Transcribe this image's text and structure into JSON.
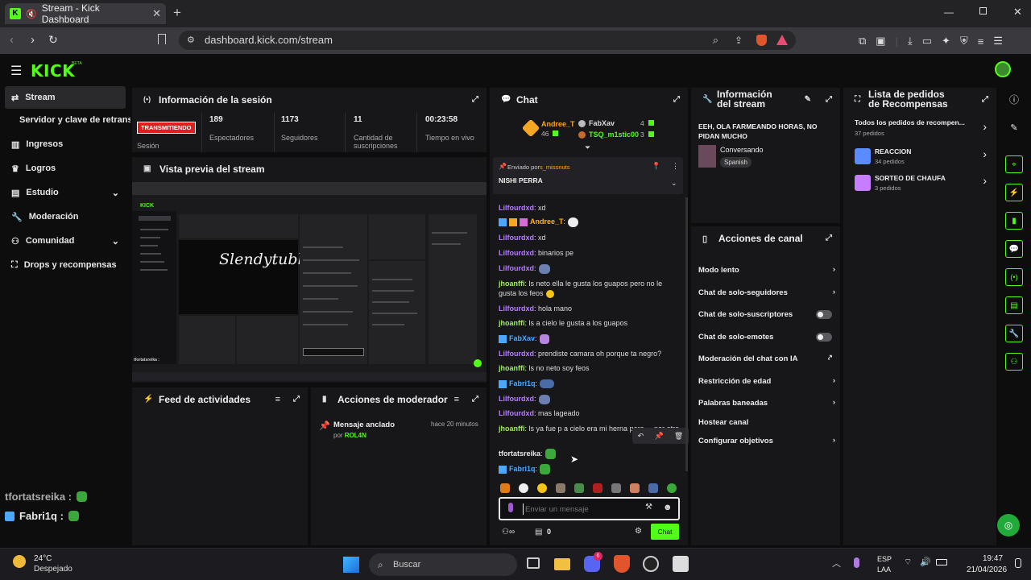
{
  "browser": {
    "tab_title": "Stream - Kick Dashboard",
    "url": "dashboard.kick.com/stream"
  },
  "brand": {
    "logo": "KICK",
    "beta": "BETA",
    "accent": "#53fc18"
  },
  "nav": {
    "items": [
      {
        "label": "Stream",
        "icon": "stream-icon"
      },
      {
        "label": "Servidor y clave de retransn",
        "icon": ""
      },
      {
        "label": "Ingresos",
        "icon": "chart-icon"
      },
      {
        "label": "Logros",
        "icon": "trophy-icon"
      },
      {
        "label": "Estudio",
        "icon": "studio-icon"
      },
      {
        "label": "Moderación",
        "icon": "wrench-icon"
      },
      {
        "label": "Comunidad",
        "icon": "community-icon"
      },
      {
        "label": "Drops y recompensas",
        "icon": "gift-icon"
      }
    ]
  },
  "overlay_chat": [
    {
      "user": "tfortatsreika :"
    },
    {
      "user": "Fabri1q :"
    }
  ],
  "session": {
    "title": "Información de la sesión",
    "status": "TRANSMITIENDO",
    "status_label": "Sesión",
    "stats": [
      {
        "value": "189",
        "label": "Espectadores"
      },
      {
        "value": "1173",
        "label": "Seguidores"
      },
      {
        "value": "11",
        "label": "Cantidad de suscripciones"
      },
      {
        "value": "00:23:58",
        "label": "Tiempo en vivo"
      }
    ]
  },
  "preview": {
    "title": "Vista previa del stream",
    "overlay_text": "Slendytubbies",
    "mini_user": "tfortatsreika :"
  },
  "activity": {
    "title": "Feed de actividades"
  },
  "modactions": {
    "title": "Acciones de moderador",
    "item_title": "Mensaje anclado",
    "item_time": "hace 20 minutos",
    "item_by": "por",
    "item_user": "ROL4N"
  },
  "chat": {
    "title": "Chat",
    "top_left_user": "Andree_T",
    "top_left_count": "46",
    "top_right": [
      {
        "user": "FabXav",
        "count": "4"
      },
      {
        "user": "TSQ_m1stic00",
        "count": "3"
      }
    ],
    "pinned_prefix": "Enviado por",
    "pinned_user": "s_missnuts",
    "pinned_text": "NISHI PERRA",
    "messages": [
      {
        "user": "Lilfourdxd",
        "text": ": xd",
        "color": "#b67cff"
      },
      {
        "user": "Andree_T",
        "text": ":",
        "color": "#ffb020"
      },
      {
        "user": "Lilfourdxd",
        "text": ": xd",
        "color": "#b67cff"
      },
      {
        "user": "Lilfourdxd",
        "text": ": binarios pe",
        "color": "#b67cff"
      },
      {
        "user": "Lilfourdxd",
        "text": ":",
        "color": "#b67cff"
      },
      {
        "user": "jhoanffi",
        "text": ": ls neto ella le gusta los guapos pero no le gusta los feos",
        "color": "#a0e860"
      },
      {
        "user": "Lilfourdxd",
        "text": ": hola mano",
        "color": "#b67cff"
      },
      {
        "user": "jhoanffi",
        "text": ": ls a cielo le gusta a los guapos",
        "color": "#a0e860"
      },
      {
        "user": "FabXav",
        "text": ":",
        "color": "#4aa8ff"
      },
      {
        "user": "Lilfourdxd",
        "text": ": prendiste camara oh porque ta negro?",
        "color": "#b67cff"
      },
      {
        "user": "jhoanffi",
        "text": ": ls no neto soy feos",
        "color": "#a0e860"
      },
      {
        "user": "Fabri1q",
        "text": ":",
        "color": "#4aa8ff"
      },
      {
        "user": "Lilfourdxd",
        "text": ":",
        "color": "#b67cff"
      },
      {
        "user": "Lilfourdxd",
        "text": ": mas lageado",
        "color": "#b67cff"
      },
      {
        "user": "jhoanffi",
        "text": ": ls ya fue p a cielo era mi herna pero ... por otro",
        "color": "#a0e860"
      },
      {
        "user": "tfortatsreika",
        "text": ":",
        "color": "#e8e8e8"
      },
      {
        "user": "Fabri1q",
        "text": ":",
        "color": "#4aa8ff"
      }
    ],
    "input_placeholder": "Enviar un mensaje",
    "points": "0",
    "send_label": "Chat"
  },
  "stream_info": {
    "title": "Información del stream",
    "stream_title": "EEH, OLA FARMEANDO HORAS, NO PIDAN MUCHO",
    "category": "Conversando",
    "language": "Spanish"
  },
  "channel_actions": {
    "title": "Acciones de canal",
    "items": [
      {
        "label": "Modo lento",
        "control": "chevron"
      },
      {
        "label": "Chat de solo-seguidores",
        "control": "chevron"
      },
      {
        "label": "Chat de solo-suscriptores",
        "control": "toggle"
      },
      {
        "label": "Chat de solo-emotes",
        "control": "toggle"
      },
      {
        "label": "Moderación del chat con IA",
        "control": "external"
      },
      {
        "label": "Restricción de edad",
        "control": "chevron"
      },
      {
        "label": "Palabras baneadas",
        "control": "chevron"
      },
      {
        "label": "Hostear canal",
        "control": "none"
      },
      {
        "label": "Configurar objetivos",
        "control": "chevron"
      }
    ]
  },
  "rewards": {
    "title": "Lista de pedidos de Recompensas",
    "all_label": "Todos los pedidos de recompen...",
    "all_count": "37 pedidos",
    "items": [
      {
        "name": "REACCION",
        "count": "34 pedidos",
        "color": "#5b8cff"
      },
      {
        "name": "SORTEO DE CHAUFA",
        "count": "3 pedidos",
        "color": "#c77dff"
      }
    ]
  },
  "taskbar": {
    "weather_temp": "24°C",
    "weather_desc": "Despejado",
    "search_placeholder": "Buscar",
    "discord_badge": "6",
    "lang": "ESP",
    "lang2": "LAA",
    "time": "19:47",
    "date": "21/04/2026"
  }
}
